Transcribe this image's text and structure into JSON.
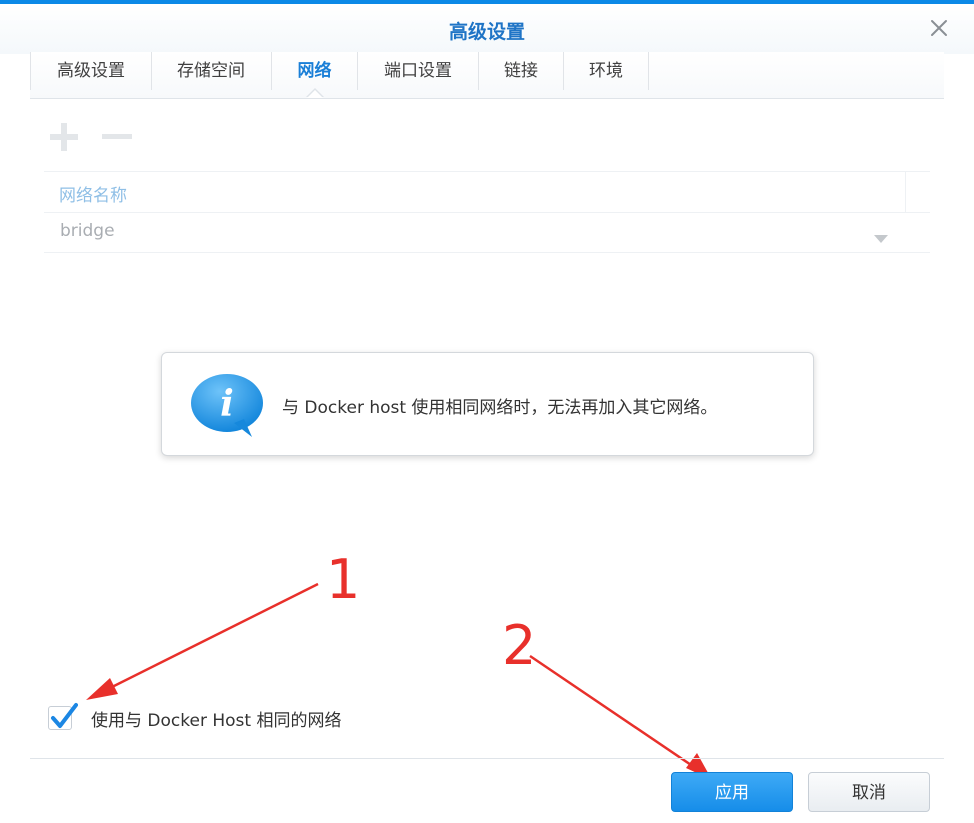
{
  "dialog": {
    "title": "高级设置",
    "close_icon": "close-icon"
  },
  "tabs": [
    {
      "label": "高级设置",
      "active": false
    },
    {
      "label": "存储空间",
      "active": false
    },
    {
      "label": "网络",
      "active": true
    },
    {
      "label": "端口设置",
      "active": false
    },
    {
      "label": "链接",
      "active": false
    },
    {
      "label": "环境",
      "active": false
    }
  ],
  "toolbar": {
    "add_icon": "plus-icon",
    "remove_icon": "minus-icon",
    "disabled": true
  },
  "network_grid": {
    "column_header": "网络名称",
    "rows": [
      {
        "value": "bridge"
      }
    ]
  },
  "info_message": {
    "icon": "info-icon",
    "text": "与 Docker host 使用相同网络时，无法再加入其它网络。"
  },
  "use_host_network": {
    "checked": true,
    "label": "使用与 Docker Host 相同的网络"
  },
  "annotations": {
    "marker_1": "1",
    "marker_2": "2",
    "color": "#e8302b"
  },
  "footer": {
    "apply_label": "应用",
    "cancel_label": "取消"
  },
  "colors": {
    "accent": "#1a7fd7",
    "title": "#1f74c6",
    "primary_button": "#168de9"
  }
}
